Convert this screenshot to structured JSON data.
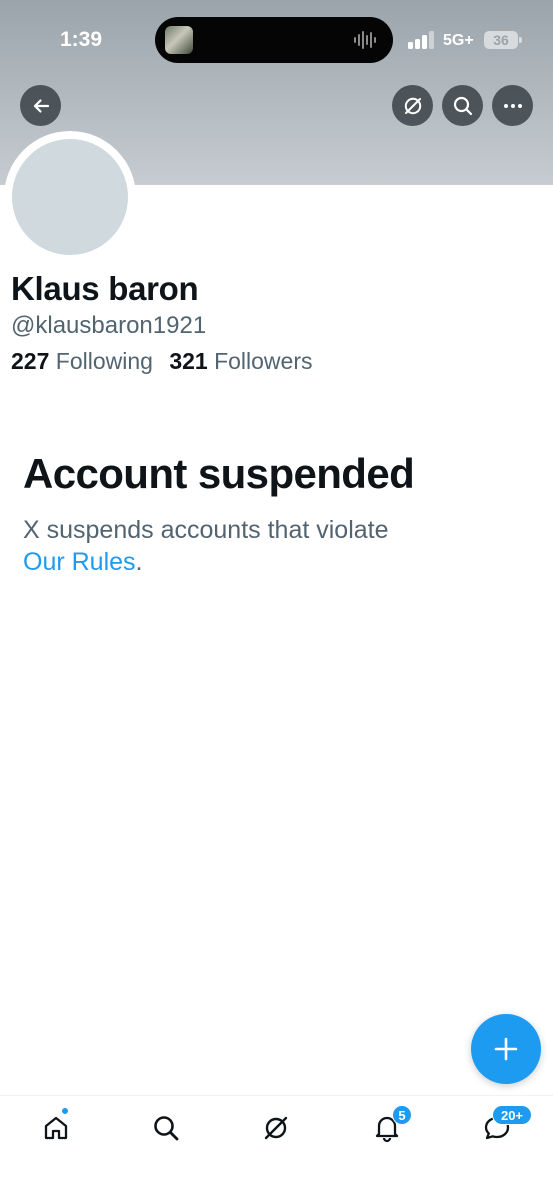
{
  "status_bar": {
    "time": "1:39",
    "network": "5G+",
    "battery": "36"
  },
  "header": {
    "back_icon": "arrow-left-icon",
    "grok_icon": "grok-icon",
    "search_icon": "search-icon",
    "more_icon": "more-horizontal-icon"
  },
  "profile": {
    "name": "Klaus baron",
    "handle": "@klausbaron1921",
    "following_count": "227",
    "following_label": "Following",
    "followers_count": "321",
    "followers_label": "Followers"
  },
  "suspension": {
    "title": "Account suspended",
    "message": "X suspends accounts that violate",
    "link_text": "Our Rules",
    "suffix": "."
  },
  "tabbar": {
    "items": [
      {
        "icon": "home-icon"
      },
      {
        "icon": "search-icon"
      },
      {
        "icon": "grok-icon"
      },
      {
        "icon": "bell-icon",
        "badge": "5"
      },
      {
        "icon": "messages-icon",
        "badge": "20+"
      }
    ]
  },
  "colors": {
    "accent": "#1d9bf0",
    "text_primary": "#0f1419",
    "text_secondary": "#536471",
    "avatar": "#cfd9de"
  }
}
